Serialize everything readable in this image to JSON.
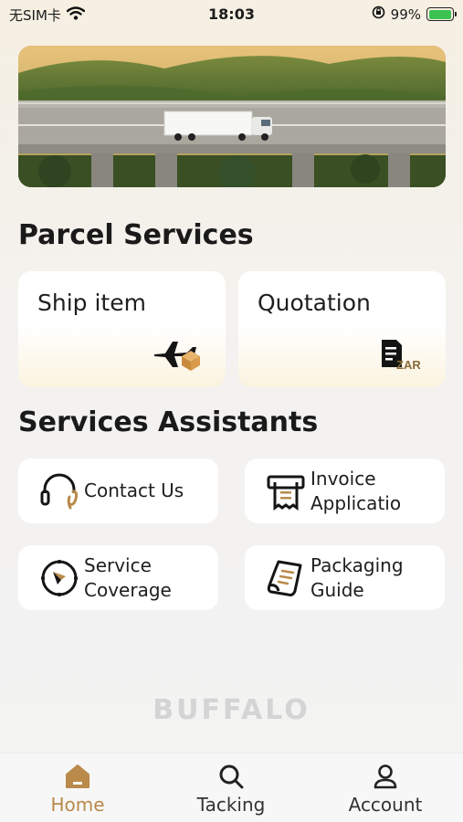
{
  "status_bar": {
    "carrier": "无SIM卡",
    "time": "18:03",
    "battery": "99%",
    "battery_level": 0.99
  },
  "banner": {
    "image": "highway-truck-photo"
  },
  "parcel_services": {
    "title": "Parcel Services",
    "items": [
      {
        "label": "Ship item",
        "icon": "plane-parcel-icon"
      },
      {
        "label": "Quotation",
        "icon": "zar-document-icon"
      }
    ]
  },
  "assistants": {
    "title": "Services Assistants",
    "items": [
      {
        "label": "Contact Us",
        "icon": "headset-icon"
      },
      {
        "label": "Invoice\nApplicatio",
        "icon": "invoice-printer-icon"
      },
      {
        "label": "Service\nCoverage",
        "icon": "compass-icon"
      },
      {
        "label": "Packaging\nGuide",
        "icon": "scroll-icon"
      }
    ]
  },
  "brand": "BUFFALO",
  "tab_bar": {
    "items": [
      {
        "label": "Home",
        "icon": "home-icon",
        "active": true
      },
      {
        "label": "Tacking",
        "icon": "search-icon",
        "active": false
      },
      {
        "label": "Account",
        "icon": "user-icon",
        "active": false
      }
    ]
  },
  "colors": {
    "accent": "#b98a4a",
    "battery": "#3bc251",
    "card": "#ffffff"
  }
}
